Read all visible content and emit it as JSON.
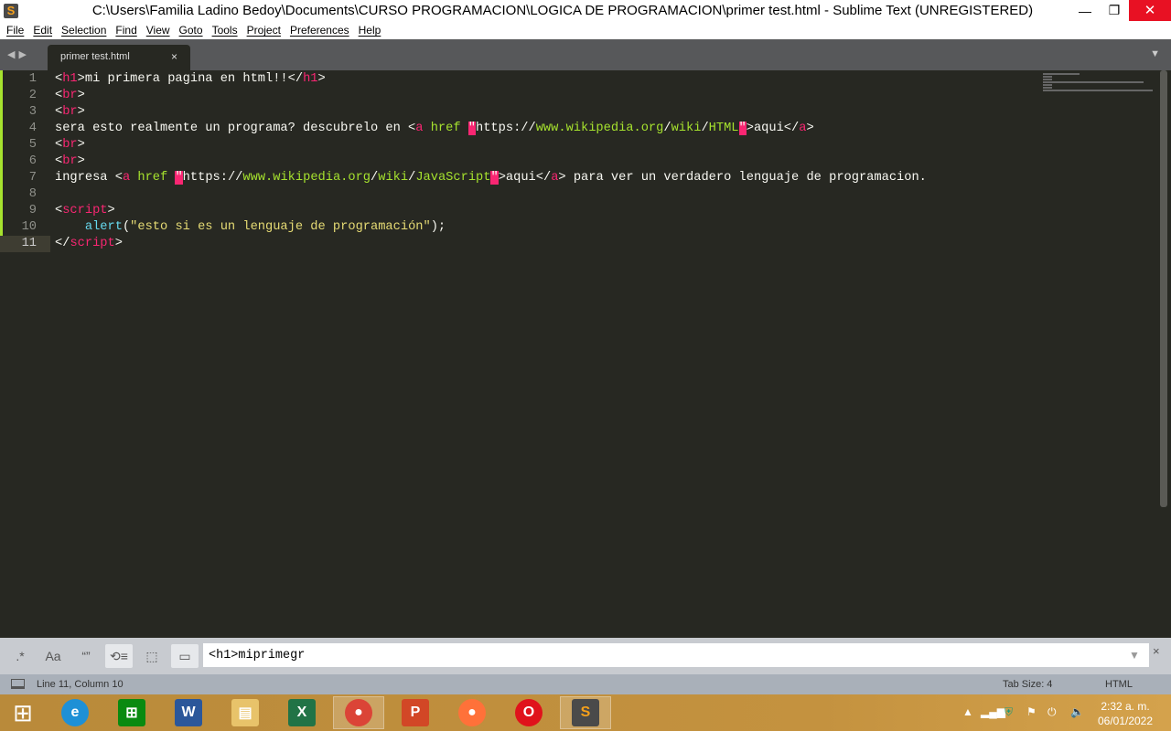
{
  "window": {
    "title": "C:\\Users\\Familia Ladino Bedoy\\Documents\\CURSO PROGRAMACION\\LOGICA DE PROGRAMACION\\primer test.html - Sublime Text (UNREGISTERED)",
    "minimize": "—",
    "restore": "❐",
    "close": "✕"
  },
  "menu": [
    "File",
    "Edit",
    "Selection",
    "Find",
    "View",
    "Goto",
    "Tools",
    "Project",
    "Preferences",
    "Help"
  ],
  "tabs": [
    {
      "label": "primer test.html",
      "close": "×"
    }
  ],
  "editor": {
    "lines": [
      [
        [
          "<",
          "plain"
        ],
        [
          "h1",
          "tag"
        ],
        [
          ">mi primera pagina en html!!</",
          "plain"
        ],
        [
          "h1",
          "tag"
        ],
        [
          ">",
          "plain"
        ]
      ],
      [
        [
          "<",
          "plain"
        ],
        [
          "br",
          "tag"
        ],
        [
          ">",
          "plain"
        ]
      ],
      [
        [
          "<",
          "plain"
        ],
        [
          "br",
          "tag"
        ],
        [
          ">",
          "plain"
        ]
      ],
      [
        [
          "sera esto realmente un programa? descubrelo en <",
          "plain"
        ],
        [
          "a",
          "tag"
        ],
        [
          " ",
          "plain"
        ],
        [
          "href",
          "attr"
        ],
        [
          " ",
          "plain"
        ],
        [
          "\"",
          "err"
        ],
        [
          "https://",
          "plain"
        ],
        [
          "www.wikipedia.org",
          "url"
        ],
        [
          "/",
          "plain"
        ],
        [
          "wiki",
          "url"
        ],
        [
          "/",
          "plain"
        ],
        [
          "HTML",
          "url"
        ],
        [
          "\"",
          "err"
        ],
        [
          ">aqui</",
          "plain"
        ],
        [
          "a",
          "tag"
        ],
        [
          ">",
          "plain"
        ]
      ],
      [
        [
          "<",
          "plain"
        ],
        [
          "br",
          "tag"
        ],
        [
          ">",
          "plain"
        ]
      ],
      [
        [
          "<",
          "plain"
        ],
        [
          "br",
          "tag"
        ],
        [
          ">",
          "plain"
        ]
      ],
      [
        [
          "ingresa <",
          "plain"
        ],
        [
          "a",
          "tag"
        ],
        [
          " ",
          "plain"
        ],
        [
          "href",
          "attr"
        ],
        [
          " ",
          "plain"
        ],
        [
          "\"",
          "err"
        ],
        [
          "https://",
          "plain"
        ],
        [
          "www.wikipedia.org",
          "url"
        ],
        [
          "/",
          "plain"
        ],
        [
          "wiki",
          "url"
        ],
        [
          "/",
          "plain"
        ],
        [
          "JavaScript",
          "url"
        ],
        [
          "\"",
          "err"
        ],
        [
          ">aqui</",
          "plain"
        ],
        [
          "a",
          "tag"
        ],
        [
          "> para ver un verdadero lenguaje de programacion.",
          "plain"
        ]
      ],
      [],
      [
        [
          "<",
          "plain"
        ],
        [
          "script",
          "tag"
        ],
        [
          ">",
          "plain"
        ]
      ],
      [
        [
          "    ",
          "plain"
        ],
        [
          "alert",
          "fn"
        ],
        [
          "(",
          "plain"
        ],
        [
          "\"esto si es un lenguaje de programación\"",
          "str"
        ],
        [
          ");",
          "plain"
        ]
      ],
      [
        [
          "</",
          "plain"
        ],
        [
          "script",
          "tag"
        ],
        [
          ">",
          "plain"
        ]
      ]
    ],
    "current_line": 11
  },
  "find": {
    "regex": ".*",
    "case": "Aa",
    "whole_word": "“”",
    "wrap": "⟲≡",
    "in_selection": "⬚",
    "highlight": "▭",
    "value": "<h1>miprimegr",
    "dropdown": "▼",
    "close": "×"
  },
  "status": {
    "position": "Line 11, Column 10",
    "tab_size": "Tab Size: 4",
    "syntax": "HTML"
  },
  "taskbar": {
    "apps": [
      {
        "name": "internet-explorer",
        "glyph": "e",
        "color": "#1e90d6"
      },
      {
        "name": "store",
        "glyph": "⊞",
        "color": "#0a8a10"
      },
      {
        "name": "word",
        "glyph": "W",
        "color": "#2b579a"
      },
      {
        "name": "file-explorer",
        "glyph": "▤",
        "color": "#e8c36a"
      },
      {
        "name": "excel",
        "glyph": "X",
        "color": "#217346"
      },
      {
        "name": "chrome",
        "glyph": "●",
        "color": "#db4437"
      },
      {
        "name": "powerpoint",
        "glyph": "P",
        "color": "#d24726"
      },
      {
        "name": "firefox",
        "glyph": "●",
        "color": "#ff7139"
      },
      {
        "name": "opera",
        "glyph": "O",
        "color": "#e0121b"
      },
      {
        "name": "sublime-text",
        "glyph": "S",
        "color": "#4a4a4a"
      }
    ],
    "active": [
      5,
      9
    ],
    "time": "2:32 a. m.",
    "date": "06/01/2022"
  }
}
